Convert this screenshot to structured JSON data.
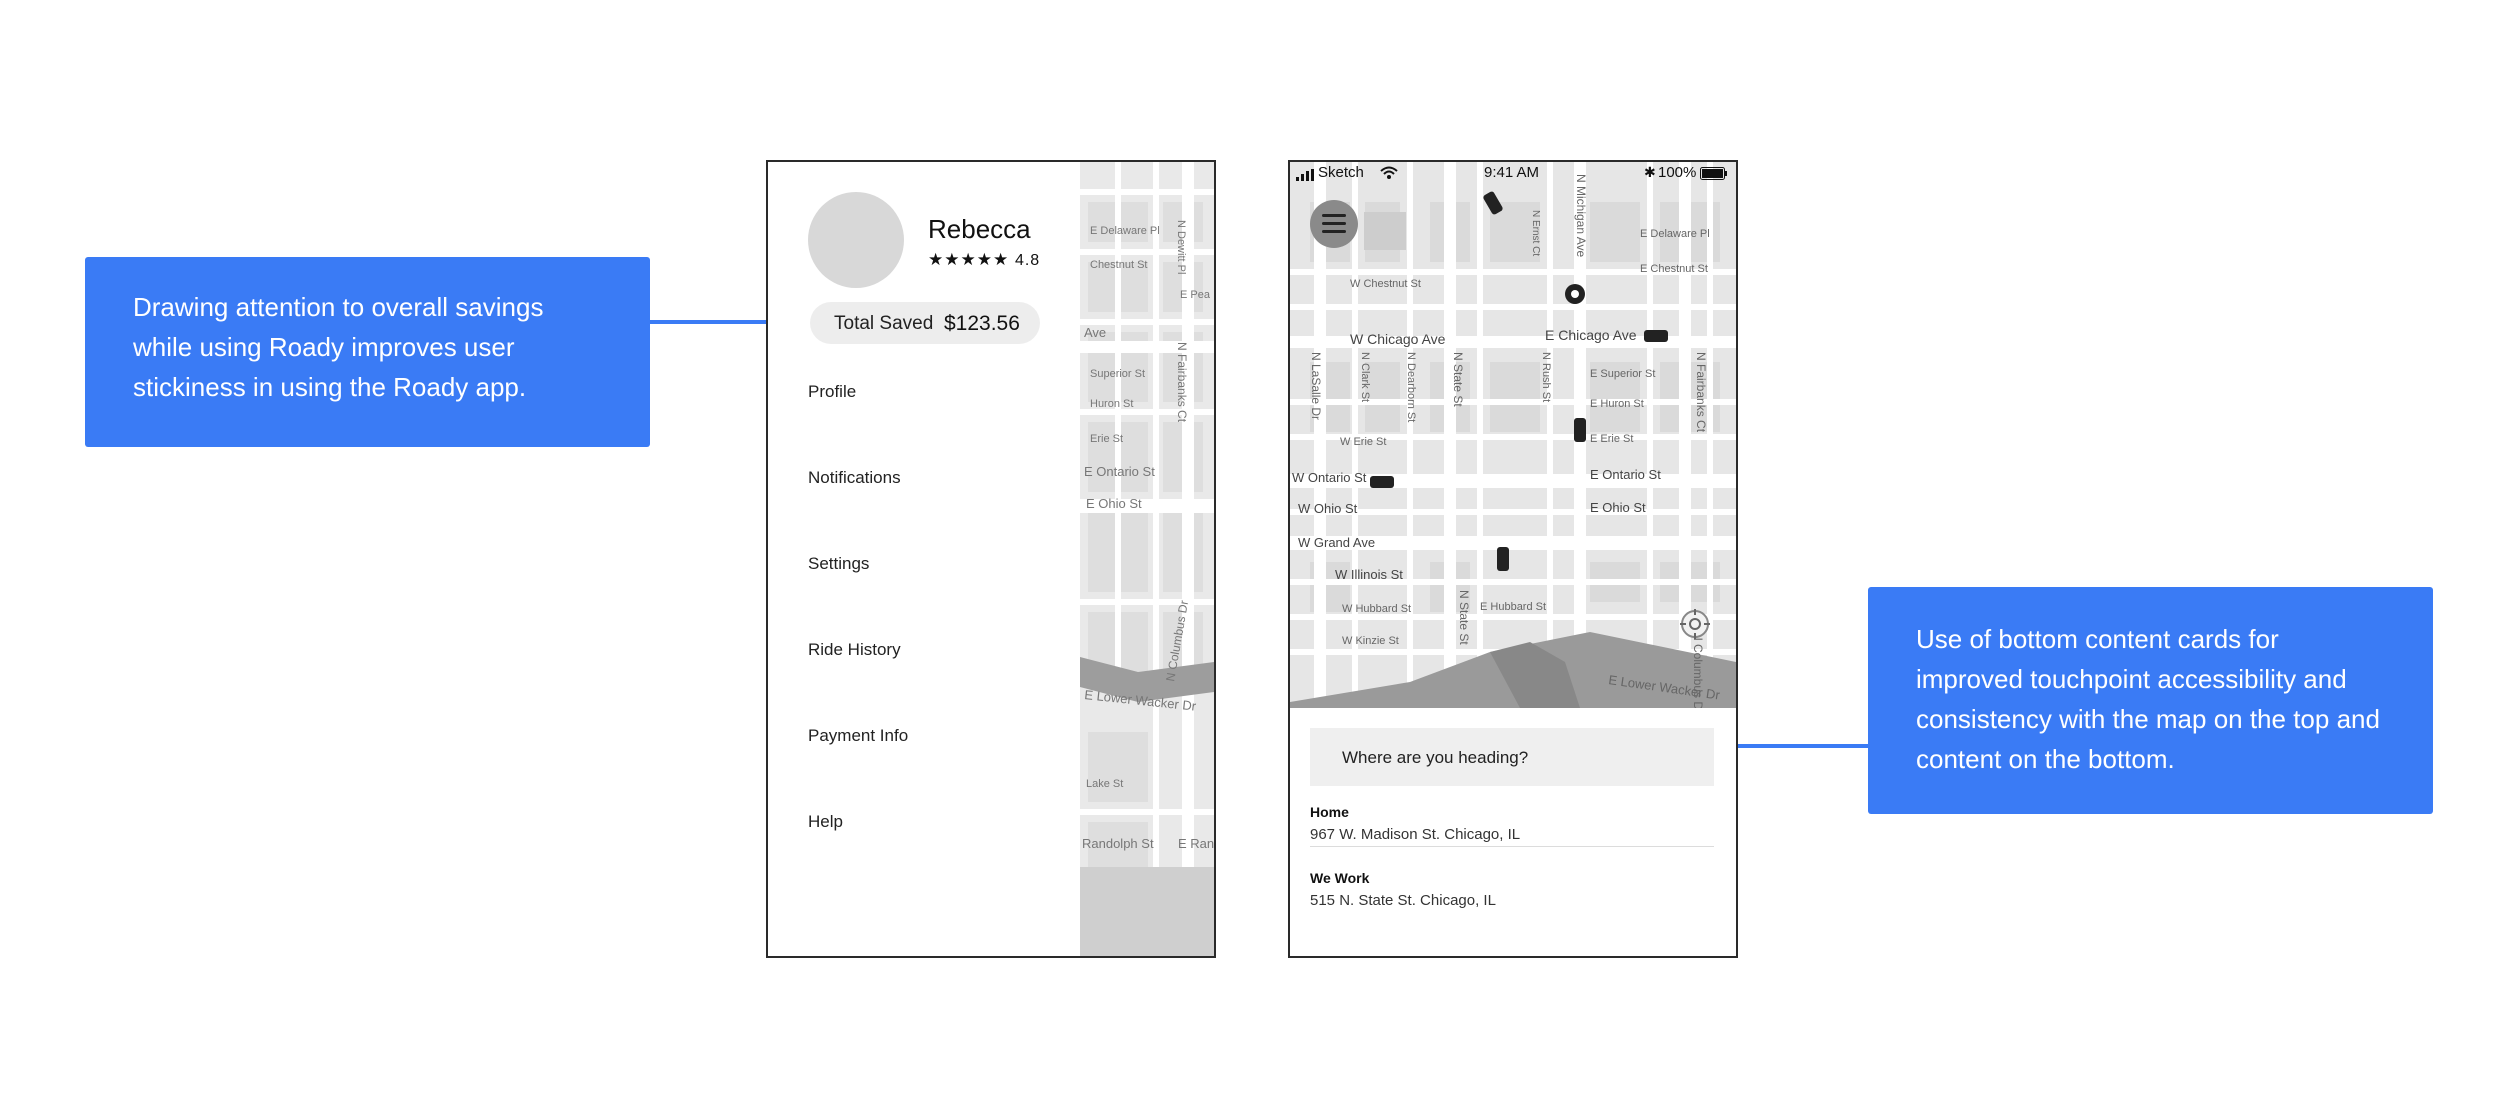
{
  "annotations": {
    "left": "Drawing attention to overall savings while using Roady improves user stickiness in using the Roady app.",
    "right": "Use of bottom content cards for improved touchpoint accessibility and consistency with the map on the top and content on the bottom."
  },
  "drawer_screen": {
    "user": {
      "name": "Rebecca",
      "stars": "★★★★★",
      "rating": "4.8"
    },
    "savings": {
      "label": "Total Saved",
      "value": "$123.56"
    },
    "menu": [
      "Profile",
      "Notifications",
      "Settings",
      "Ride History",
      "Payment Info",
      "Help"
    ],
    "map_labels": [
      "E Delaware Pl",
      "Chestnut St",
      "E Pea",
      "N Dewitt Pl",
      "Ave",
      "Superior St",
      "Huron St",
      "Erie St",
      "N Fairbanks Ct",
      "E Ontario St",
      "E Ohio St",
      "N Columbus Dr",
      "E Lower Wacker Dr",
      "Lake St",
      "Randolph St",
      "E Ran"
    ]
  },
  "map_screen": {
    "status": {
      "carrier": "Sketch",
      "time": "9:41 AM",
      "battery": "100%"
    },
    "map_labels": [
      "W Chestnut St",
      "N Michigan Ave",
      "E Delaware Pl",
      "E Chestnut St",
      "W Chicago Ave",
      "E Chicago Ave",
      "N LaSalle Dr",
      "N Clark St",
      "N Dearborn St",
      "N State St",
      "N Rush St",
      "E Superior St",
      "E Huron St",
      "E Erie St",
      "W Erie St",
      "W Ontario St",
      "E Ontario St",
      "W Ohio St",
      "E Ohio St",
      "W Grand Ave",
      "W Illinois St",
      "W Hubbard St",
      "E Hubbard St",
      "W Kinzie St",
      "N State St",
      "E Lower Wacker Dr",
      "N Fairbanks Ct",
      "N Columbus Dr",
      "N Ernst Ct"
    ],
    "search_placeholder": "Where are you heading?",
    "saved_places": [
      {
        "title": "Home",
        "address": "967 W. Madison St. Chicago, IL"
      },
      {
        "title": "We Work",
        "address": "515 N. State St. Chicago, IL"
      }
    ]
  }
}
